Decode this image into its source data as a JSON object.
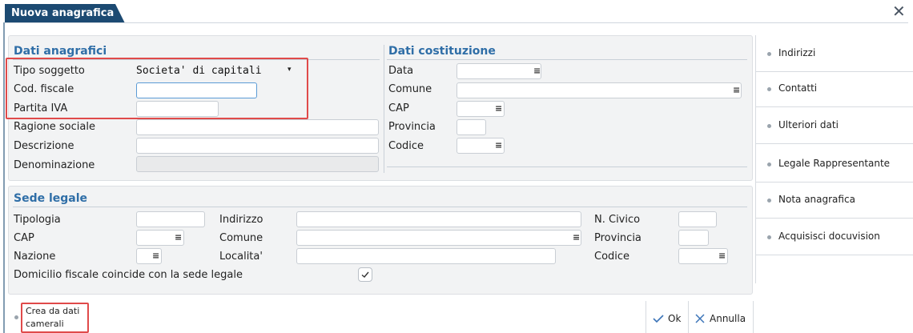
{
  "window": {
    "title": "Nuova anagrafica"
  },
  "dati_anagrafici": {
    "title": "Dati anagrafici",
    "tipo_soggetto_label": "Tipo soggetto",
    "tipo_soggetto_value": "Societa' di capitali",
    "cod_fiscale_label": "Cod. fiscale",
    "cod_fiscale_value": "",
    "partita_iva_label": "Partita IVA",
    "partita_iva_value": "",
    "ragione_sociale_label": "Ragione sociale",
    "descrizione_label": "Descrizione",
    "denominazione_label": "Denominazione"
  },
  "dati_costituzione": {
    "title": "Dati costituzione",
    "data_label": "Data",
    "comune_label": "Comune",
    "cap_label": "CAP",
    "provincia_label": "Provincia",
    "codice_label": "Codice"
  },
  "sede_legale": {
    "title": "Sede legale",
    "tipologia_label": "Tipologia",
    "indirizzo_label": "Indirizzo",
    "n_civico_label": "N. Civico",
    "cap_label": "CAP",
    "comune_label": "Comune",
    "provincia_label": "Provincia",
    "nazione_label": "Nazione",
    "localita_label": "Localita'",
    "codice_label": "Codice",
    "domicilio_label": "Domicilio fiscale coincide con la sede legale",
    "domicilio_checked": true
  },
  "side_menu": {
    "items": [
      {
        "label": "Indirizzi"
      },
      {
        "label": "Contatti"
      },
      {
        "label": "Ulteriori dati"
      },
      {
        "label": "Legale Rappresentante"
      },
      {
        "label": "Nota anagrafica"
      },
      {
        "label": "Acquisisci docuvision"
      }
    ]
  },
  "footer": {
    "crea_line1": "Crea da dati",
    "crea_line2": "camerali",
    "ok_label": "Ok",
    "annulla_label": "Annulla"
  },
  "icons": {
    "dropdown": "lines-menu-icon",
    "check": "check-icon",
    "close": "close-icon"
  },
  "colors": {
    "title_bar": "#1c4a72",
    "section_title": "#2f6ea7",
    "highlight_box": "#e04a4a",
    "panel": "#f2f3f4"
  }
}
